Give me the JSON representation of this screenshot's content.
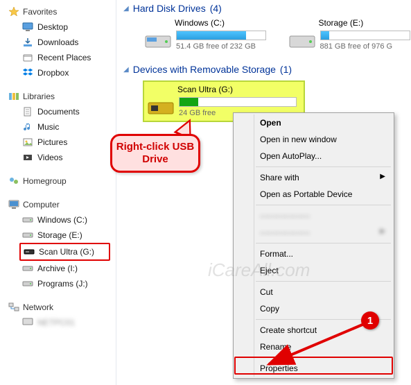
{
  "sidebar": {
    "favorites": {
      "label": "Favorites",
      "items": [
        "Desktop",
        "Downloads",
        "Recent Places",
        "Dropbox"
      ]
    },
    "libraries": {
      "label": "Libraries",
      "items": [
        "Documents",
        "Music",
        "Pictures",
        "Videos"
      ]
    },
    "homegroup": {
      "label": "Homegroup"
    },
    "computer": {
      "label": "Computer",
      "items": [
        "Windows (C:)",
        "Storage (E:)",
        "Scan Ultra (G:)",
        "Archive (I:)",
        "Programs (J:)"
      ]
    },
    "network": {
      "label": "Network"
    }
  },
  "groups": {
    "hdd": {
      "label": "Hard Disk Drives",
      "count": "(4)"
    },
    "removable": {
      "label": "Devices with Removable Storage",
      "count": "(1)"
    }
  },
  "drives": {
    "c": {
      "title": "Windows (C:)",
      "sub": "51.4 GB free of 232 GB"
    },
    "e": {
      "title": "Storage (E:)",
      "sub": "881 GB free of 976 G"
    },
    "g": {
      "title": "Scan Ultra (G:)",
      "sub": "24    GB free"
    }
  },
  "ctx": {
    "open": "Open",
    "open_new": "Open in new window",
    "autoplay": "Open AutoPlay...",
    "share": "Share with",
    "portable": "Open as Portable Device",
    "blur1": "——————",
    "blur2": "——————",
    "format": "Format...",
    "eject": "Eject",
    "cut": "Cut",
    "copy": "Copy",
    "shortcut": "Create shortcut",
    "rename": "Rename",
    "properties": "Properties"
  },
  "annotations": {
    "callout": "Right-click USB Drive",
    "badge1": "1",
    "watermark": "iCareAll.com"
  }
}
